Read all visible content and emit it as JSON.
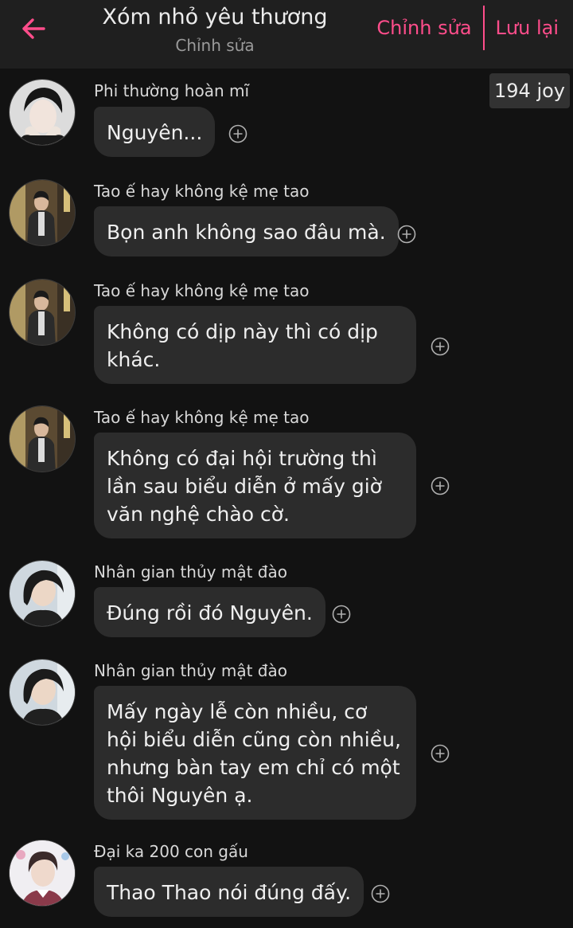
{
  "header": {
    "title": "Xóm nhỏ yêu thương",
    "subtitle": "Chỉnh sửa",
    "edit_label": "Chỉnh sửa",
    "save_label": "Lưu lại",
    "accent_color": "#ff4d8b"
  },
  "joy_badge": "194 joy",
  "messages": [
    {
      "sender": "Phi thường hoàn mĩ",
      "text": "Nguyên..."
    },
    {
      "sender": "Tao ế hay không kệ mẹ tao",
      "text": "Bọn anh không sao đâu mà."
    },
    {
      "sender": "Tao ế hay không kệ mẹ tao",
      "text": "Không có dịp này thì có dịp khác."
    },
    {
      "sender": "Tao ế hay không kệ mẹ tao",
      "text": "Không có đại hội trường thì lần sau biểu diễn ở mấy giờ văn nghệ chào cờ."
    },
    {
      "sender": "Nhân gian thủy mật đào",
      "text": "Đúng rồi đó Nguyên."
    },
    {
      "sender": "Nhân gian thủy mật đào",
      "text": "Mấy ngày lễ còn nhiều, cơ hội biểu diễn cũng còn nhiều, nhưng bàn tay em chỉ có một thôi Nguyên ạ."
    },
    {
      "sender": "Đại ka 200 con gấu",
      "text": "Thao Thao nói đúng đấy."
    }
  ]
}
